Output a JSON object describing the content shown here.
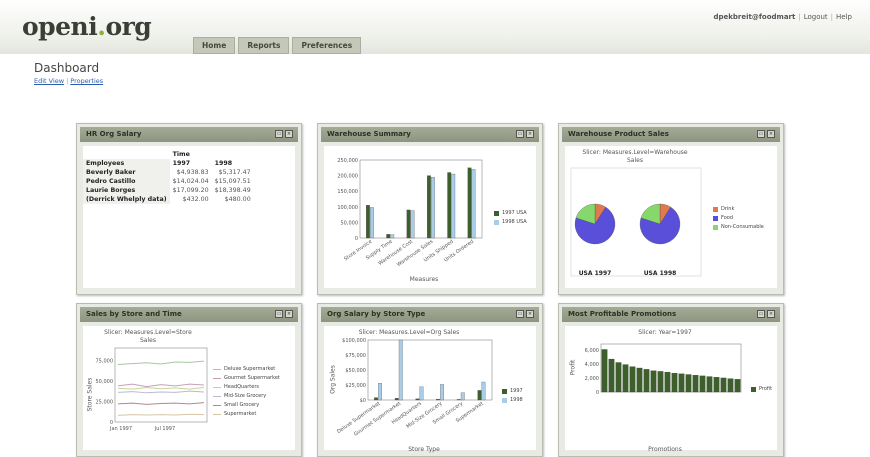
{
  "app": {
    "logo_main": "openi",
    "logo_dot": ".",
    "logo_tld": "org",
    "user": "dpekbreit@foodmart",
    "logout": "Logout",
    "help": "Help"
  },
  "tabs": [
    "Home",
    "Reports",
    "Preferences"
  ],
  "dashboard": {
    "title": "Dashboard",
    "edit_view": "Edit View",
    "properties": "Properties"
  },
  "panels": {
    "hr": {
      "title": "HR Org Salary",
      "time_header": "Time",
      "columns": [
        "Employees",
        "1997",
        "1998"
      ],
      "rows": [
        {
          "name": "Beverly Baker",
          "v1997": "$4,938.83",
          "v1998": "$5,317.47"
        },
        {
          "name": "Pedro Castillo",
          "v1997": "$14,024.04",
          "v1998": "$15,097.51"
        },
        {
          "name": "Laurie Borges",
          "v1997": "$17,099.20",
          "v1998": "$18,398.49"
        },
        {
          "name": "(Derrick Whelply data)",
          "v1997": "$432.00",
          "v1998": "$480.00"
        }
      ]
    },
    "warehouse_summary": {
      "title": "Warehouse Summary",
      "xlabel": "Measures",
      "legend": [
        "1997 USA",
        "1998 USA"
      ]
    },
    "warehouse_product": {
      "title": "Warehouse Product Sales",
      "subtitle_line1": "Slicer: Measures.Level=Warehouse",
      "subtitle_line2": "Sales",
      "pie_labels": [
        "USA 1997",
        "USA 1998"
      ],
      "legend": [
        "Drink",
        "Food",
        "Non-Consumable"
      ]
    },
    "store_time": {
      "title": "Sales by Store and Time",
      "subtitle_line1": "Slicer: Measures.Level=Store",
      "subtitle_line2": "Sales",
      "ylabel": "Store Sales",
      "legend": [
        "Deluxe Supermarket",
        "Gourmet Supermarket",
        "HeadQuarters",
        "Mid-Size Grocery",
        "Small Grocery",
        "Supermarket"
      ]
    },
    "org_store_type": {
      "title": "Org Salary by Store Type",
      "subtitle": "Slicer: Measures.Level=Org Sales",
      "ylabel": "Org Sales",
      "xlabel": "Store Type",
      "legend": [
        "1997",
        "1998"
      ]
    },
    "promotions": {
      "title": "Most Profitable Promotions",
      "subtitle": "Slicer: Year=1997",
      "ylabel": "Profit",
      "xlabel": "Promotions",
      "legend": [
        "Profit"
      ]
    }
  },
  "chart_data": [
    {
      "type": "bar",
      "title": "Warehouse Summary",
      "xlabel": "Measures",
      "ylabel": "",
      "categories": [
        "Store Invoice",
        "Supply Time",
        "Warehouse Cost",
        "Warehouse Sales",
        "Units Shipped",
        "Units Ordered"
      ],
      "series": [
        {
          "name": "1997 USA",
          "values": [
            105000,
            12000,
            90000,
            200000,
            210000,
            225000
          ]
        },
        {
          "name": "1998 USA",
          "values": [
            98000,
            11000,
            88000,
            195000,
            205000,
            220000
          ]
        }
      ],
      "ylim": [
        0,
        250000
      ],
      "yticks": [
        "250,000",
        "200,000",
        "150,000",
        "100,000",
        "50,000",
        "0"
      ],
      "colors": [
        "#3c5f2b",
        "#a9cde6"
      ]
    },
    {
      "type": "pie",
      "title": "Warehouse Product Sales",
      "pies": [
        {
          "name": "USA 1997",
          "values": [
            9,
            71,
            20
          ]
        },
        {
          "name": "USA 1998",
          "values": [
            9,
            71,
            20
          ]
        }
      ],
      "categories": [
        "Drink",
        "Food",
        "Non-Consumable"
      ],
      "colors": [
        "#e07a4e",
        "#5a4fd8",
        "#86d86c"
      ]
    },
    {
      "type": "line",
      "title": "Sales by Store and Time",
      "ylabel": "Store Sales",
      "x": [
        "Jan 1997",
        "Jul 1997"
      ],
      "yticks": [
        "75,000",
        "50,000",
        "25,000",
        "0"
      ],
      "ylim": [
        0,
        90000
      ],
      "series": [
        {
          "name": "Deluxe Supermarket",
          "values": [
            70000,
            71000,
            72000,
            70500,
            73000,
            72500,
            74000
          ]
        },
        {
          "name": "Gourmet Supermarket",
          "values": [
            44000,
            46000,
            43000,
            45500,
            44000,
            46000,
            45000
          ]
        },
        {
          "name": "HeadQuarters",
          "values": [
            41000,
            40000,
            42000,
            40500,
            41500,
            40000,
            42000
          ]
        },
        {
          "name": "Mid-Size Grocery",
          "values": [
            36000,
            37000,
            35500,
            36500,
            36000,
            37500,
            36500
          ]
        },
        {
          "name": "Small Grocery",
          "values": [
            22000,
            23000,
            21500,
            22500,
            23000,
            22000,
            23500
          ]
        },
        {
          "name": "Supermarket",
          "values": [
            8000,
            9000,
            8500,
            9000,
            8500,
            9500,
            9000
          ]
        }
      ],
      "colors": [
        "#a8c8a0",
        "#c7a0b8",
        "#c8d39a",
        "#b9b9d4",
        "#b08a8a",
        "#d6c6a6"
      ]
    },
    {
      "type": "bar",
      "title": "Org Salary by Store Type",
      "ylabel": "Org Sales",
      "xlabel": "Store Type",
      "categories": [
        "Deluxe Supermarket",
        "Gourmet Supermarket",
        "HeadQuarters",
        "Mid-Size Grocery",
        "Small Grocery",
        "Supermarket"
      ],
      "series": [
        {
          "name": "1997",
          "values": [
            4000,
            3000,
            2000,
            1500,
            1000,
            16000
          ]
        },
        {
          "name": "1998",
          "values": [
            28000,
            100000,
            22000,
            26000,
            12000,
            30000
          ]
        }
      ],
      "ylim": [
        0,
        100000
      ],
      "yticks": [
        "$100,000",
        "$75,000",
        "$50,000",
        "$25,000",
        "$0"
      ],
      "colors": [
        "#3c5f2b",
        "#a9cde6"
      ]
    },
    {
      "type": "bar",
      "title": "Most Profitable Promotions",
      "ylabel": "Profit",
      "xlabel": "Promotions",
      "series": [
        {
          "name": "Profit",
          "values": [
            6200,
            4800,
            4300,
            4000,
            3700,
            3500,
            3300,
            3100,
            3000,
            2900,
            2750,
            2650,
            2550,
            2450,
            2350,
            2250,
            2150,
            2050,
            1950,
            1850
          ]
        }
      ],
      "ylim": [
        0,
        7000
      ],
      "yticks": [
        "6,000",
        "4,000",
        "2,000",
        "0"
      ],
      "colors": [
        "#3c5f2b"
      ]
    }
  ]
}
